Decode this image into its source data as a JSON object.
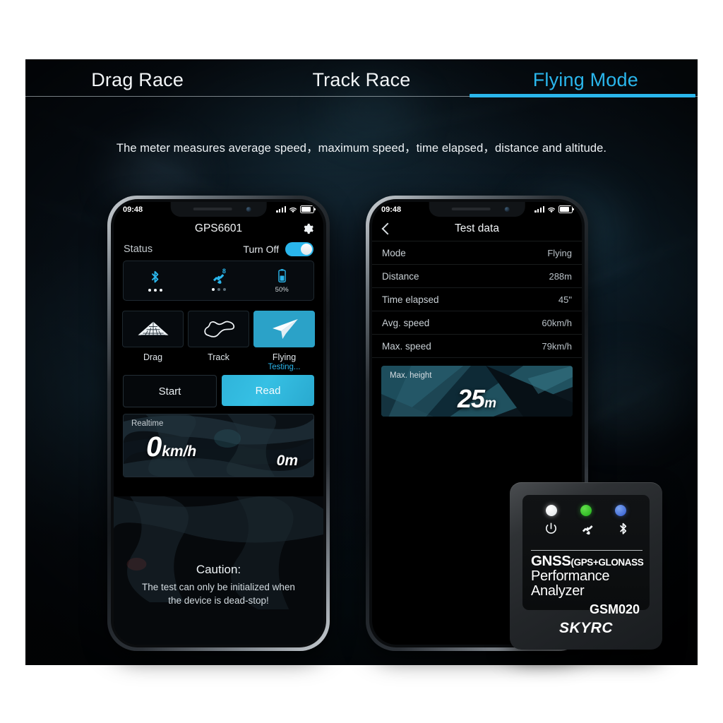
{
  "tabs": [
    {
      "label": "Drag Race",
      "active": false
    },
    {
      "label": "Track Race",
      "active": false
    },
    {
      "label": "Flying Mode",
      "active": true
    }
  ],
  "subtitle": "The meter measures average speed，maximum speed，time elapsed，distance and altitude.",
  "accent_color": "#2ab6ec",
  "phone1": {
    "status_bar": {
      "time": "09:48",
      "battery_icon": "battery-full-icon",
      "wifi_icon": "wifi-icon",
      "signal_icon": "signal-bars-icon"
    },
    "app_title": "GPS6601",
    "gear_icon": "gear-icon",
    "status_label": "Status",
    "toggle_label": "Turn Off",
    "toggle_state": "on",
    "indicators": [
      {
        "icon": "bluetooth-icon",
        "badge": "",
        "sub": "dots-three",
        "value": ""
      },
      {
        "icon": "satellite-icon",
        "badge": "8",
        "sub": "dots-three-dim",
        "value": ""
      },
      {
        "icon": "battery-icon",
        "badge": "",
        "sub": "",
        "value": "50%"
      }
    ],
    "modes": [
      {
        "label": "Drag",
        "icon": "drag-strip-icon",
        "selected": false,
        "sub": ""
      },
      {
        "label": "Track",
        "icon": "race-track-icon",
        "selected": false,
        "sub": ""
      },
      {
        "label": "Flying",
        "icon": "paper-plane-icon",
        "selected": true,
        "sub": "Testing..."
      }
    ],
    "buttons": [
      {
        "label": "Start",
        "style": "ghost"
      },
      {
        "label": "Read",
        "style": "primary"
      }
    ],
    "realtime": {
      "label": "Realtime",
      "speed_value": "0",
      "speed_unit": "km/h",
      "distance": "0m"
    },
    "caution": {
      "heading": "Caution:",
      "line1": "The test can only be initialized when",
      "line2": "the device is dead-stop!"
    }
  },
  "phone2": {
    "status_bar": {
      "time": "09:48",
      "battery_icon": "battery-full-icon",
      "wifi_icon": "wifi-icon",
      "signal_icon": "signal-bars-icon"
    },
    "back_icon": "back-chevron-icon",
    "app_title": "Test data",
    "rows": [
      {
        "key": "Mode",
        "value": "Flying"
      },
      {
        "key": "Distance",
        "value": "288m"
      },
      {
        "key": "Time elapsed",
        "value": "45\""
      },
      {
        "key": "Avg. speed",
        "value": "60km/h"
      },
      {
        "key": "Max. speed",
        "value": "79km/h"
      }
    ],
    "max_height": {
      "label": "Max. height",
      "value": "25",
      "unit": "m"
    }
  },
  "device": {
    "leds": [
      {
        "name": "power-led",
        "color": "#ffffff"
      },
      {
        "name": "gnss-led",
        "color": "#3cc92a"
      },
      {
        "name": "bluetooth-led",
        "color": "#4a7ae0"
      }
    ],
    "icons": [
      "power-icon",
      "satellite-icon",
      "bluetooth-icon"
    ],
    "title_main": "GNSS",
    "title_paren": "(GPS+GLONASS",
    "line2": "Performance",
    "line3": "Analyzer",
    "model": "GSM020",
    "brand": "SKYRC"
  }
}
